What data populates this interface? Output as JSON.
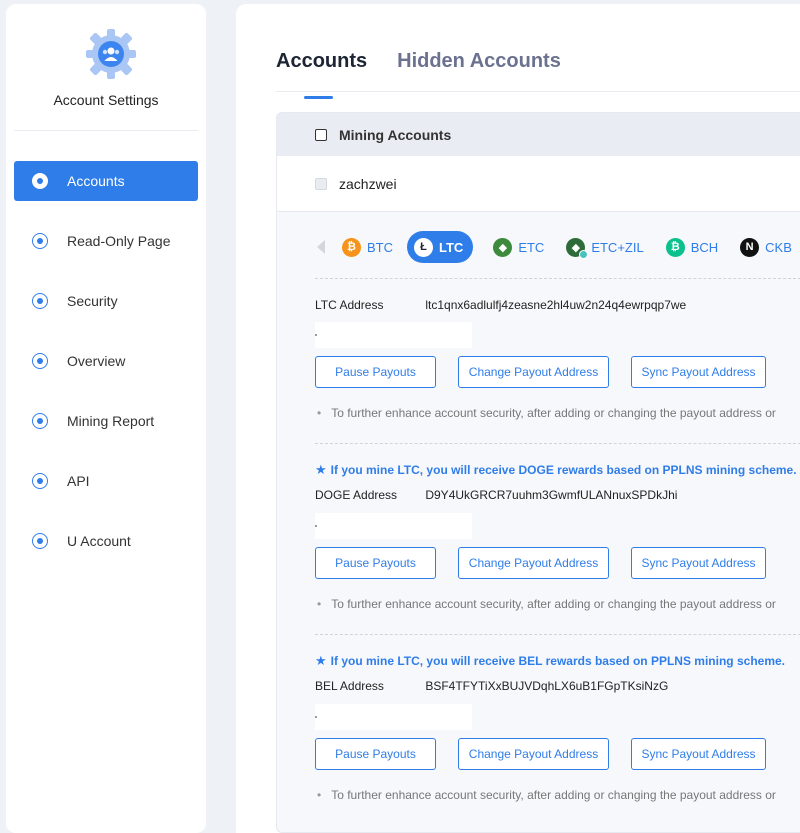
{
  "sidebar": {
    "title": "Account Settings",
    "items": [
      {
        "label": "Accounts",
        "active": true
      },
      {
        "label": "Read-Only Page"
      },
      {
        "label": "Security"
      },
      {
        "label": "Overview"
      },
      {
        "label": "Mining Report"
      },
      {
        "label": "API"
      },
      {
        "label": "U Account"
      }
    ]
  },
  "tabs": [
    {
      "label": "Accounts",
      "active": true
    },
    {
      "label": "Hidden Accounts"
    }
  ],
  "group": {
    "header": "Mining Accounts",
    "account": "zachzwei"
  },
  "coins": [
    {
      "symbol": "BTC",
      "color": "#f7931a",
      "glyph": "₿"
    },
    {
      "symbol": "LTC",
      "color": "#2f7de8",
      "glyph": "Ł",
      "active": true
    },
    {
      "symbol": "ETC",
      "color": "#3ab83a",
      "glyph": "◆"
    },
    {
      "symbol": "ETC+ZIL",
      "color": "#328332",
      "glyph": "◆"
    },
    {
      "symbol": "BCH",
      "color": "#0ac18e",
      "glyph": "₿"
    },
    {
      "symbol": "CKB",
      "color": "#111111",
      "glyph": "N"
    }
  ],
  "buttons": {
    "pause": "Pause Payouts",
    "change": "Change Payout Address",
    "sync": "Sync Payout Address"
  },
  "note": "To further enhance account security, after adding or changing the payout address or",
  "sections": [
    {
      "promo": "",
      "address_label": "LTC Address",
      "address": "ltc1qnx6adlulfj4zeasne2hl4uw2n24q4ewrpqp7we"
    },
    {
      "promo": "If you mine LTC, you will receive DOGE rewards based on PPLNS mining scheme.",
      "address_label": "DOGE Address",
      "address": "D9Y4UkGRCR7uuhm3GwmfULANnuxSPDkJhi"
    },
    {
      "promo": "If you mine LTC, you will receive BEL rewards based on PPLNS mining scheme.",
      "address_label": "BEL Address",
      "address": "BSF4TFYTiXxBUJVDqhLX6uB1FGpTKsiNzG"
    }
  ]
}
